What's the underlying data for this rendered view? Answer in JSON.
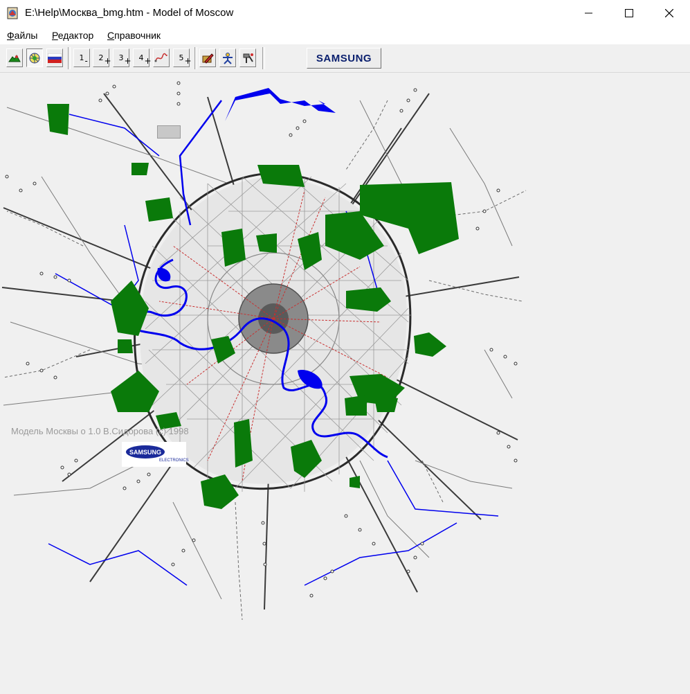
{
  "window": {
    "title": "E:\\Help\\Москва_bmg.htm - Model of Moscow"
  },
  "menu": {
    "files": {
      "hot": "Ф",
      "rest": "айлы"
    },
    "editor": {
      "hot": "Р",
      "rest": "едактор"
    },
    "reference": {
      "hot": "С",
      "rest": "правочник"
    }
  },
  "toolbar": {
    "view_buttons": [
      "map-tree-icon",
      "globe-icon",
      "russia-flag-icon"
    ],
    "level_buttons": [
      {
        "num": "1",
        "sign": "-"
      },
      {
        "num": "2",
        "sign": "+"
      },
      {
        "num": "3",
        "sign": "+"
      },
      {
        "num": "4",
        "sign": "+"
      },
      {
        "num": "5",
        "sign": "+"
      }
    ],
    "tool_buttons": [
      "pencil-icon",
      "person-icon",
      "tool-icon"
    ],
    "samsung_label": "SAMSUNG"
  },
  "map": {
    "watermark": "Модель Москвы  о  1.0  В.Сидорова  (c)  1998",
    "logo_text": "SAMSUNG",
    "logo_subtext": "ELECTRONICS"
  },
  "colors": {
    "park": "#0a7a0a",
    "water": "#0000ee",
    "road": "#333333",
    "rail_dots": "#555555"
  }
}
